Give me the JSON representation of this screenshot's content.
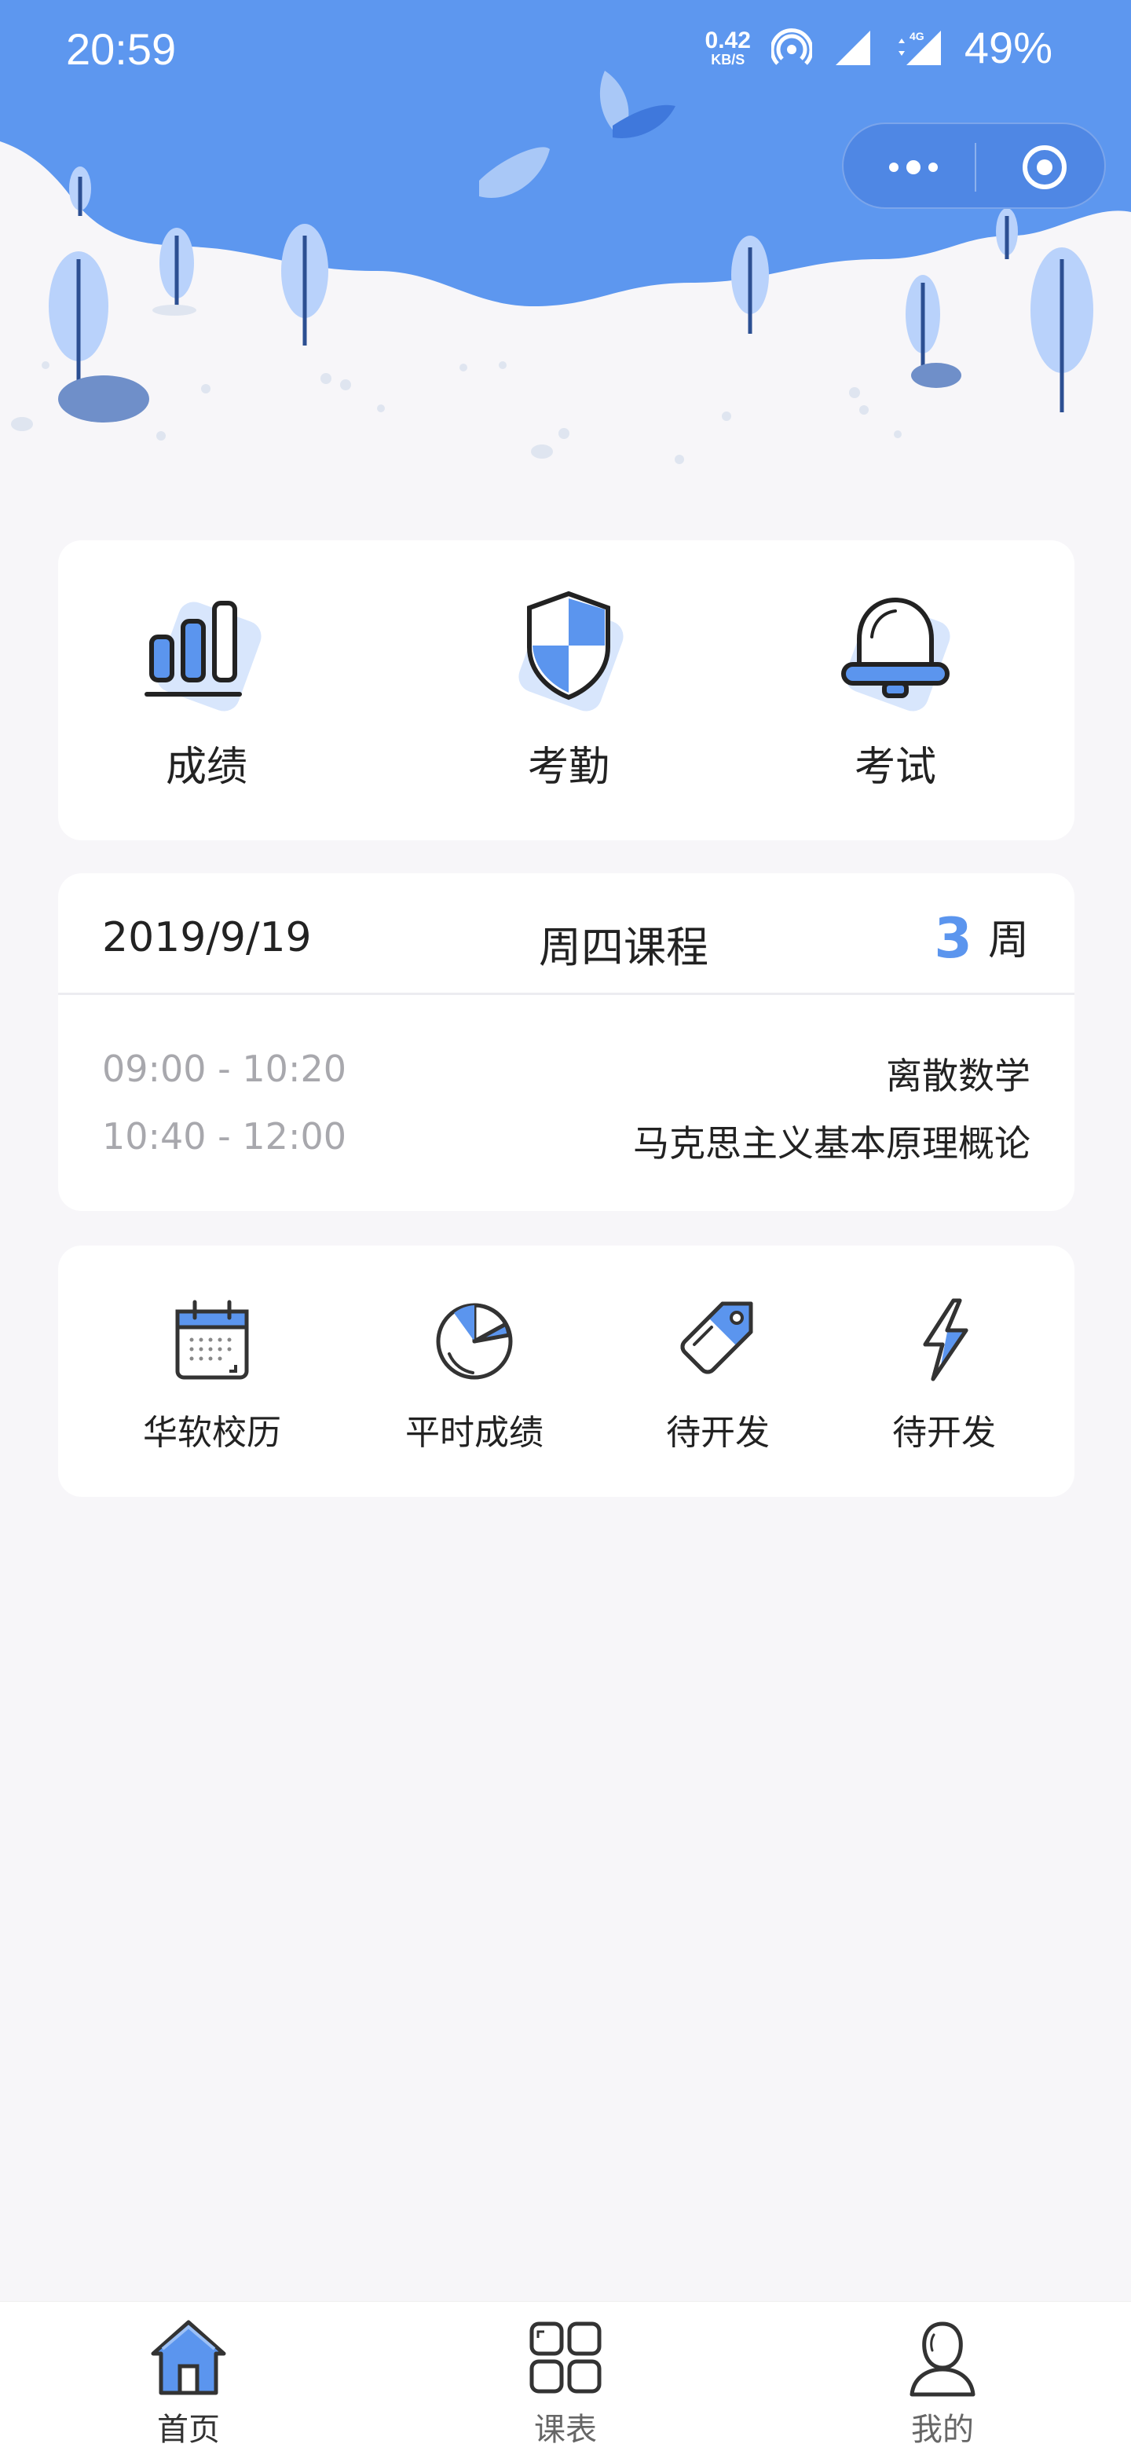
{
  "status_bar": {
    "time": "20:59",
    "net_speed_value": "0.42",
    "net_speed_unit": "KB/S",
    "network_type": "4G",
    "battery": "49%"
  },
  "capsule": {
    "more_icon": "more-dots-icon",
    "close_icon": "target-circle-icon"
  },
  "features": [
    {
      "label": "成绩",
      "icon": "bar-chart-icon"
    },
    {
      "label": "考勤",
      "icon": "shield-icon"
    },
    {
      "label": "考试",
      "icon": "bell-icon"
    }
  ],
  "schedule": {
    "date": "2019/9/19",
    "title": "周四课程",
    "week_number": "3",
    "week_unit": "周",
    "rows": [
      {
        "time": "09:00 - 10:20",
        "course": "离散数学"
      },
      {
        "time": "10:40 - 12:00",
        "course": "马克思主义基本原理概论"
      }
    ]
  },
  "tools": [
    {
      "label": "华软校历",
      "icon": "calendar-icon"
    },
    {
      "label": "平时成绩",
      "icon": "pie-chart-icon"
    },
    {
      "label": "待开发",
      "icon": "tag-icon"
    },
    {
      "label": "待开发",
      "icon": "lightning-icon"
    }
  ],
  "tabbar": [
    {
      "label": "首页",
      "icon": "home-icon",
      "active": true
    },
    {
      "label": "课表",
      "icon": "grid-icon",
      "active": false
    },
    {
      "label": "我的",
      "icon": "user-icon",
      "active": false
    }
  ],
  "colors": {
    "accent": "#5b95ee",
    "header_sky": "#5d97ef",
    "page_bg": "#f7f6f9"
  }
}
